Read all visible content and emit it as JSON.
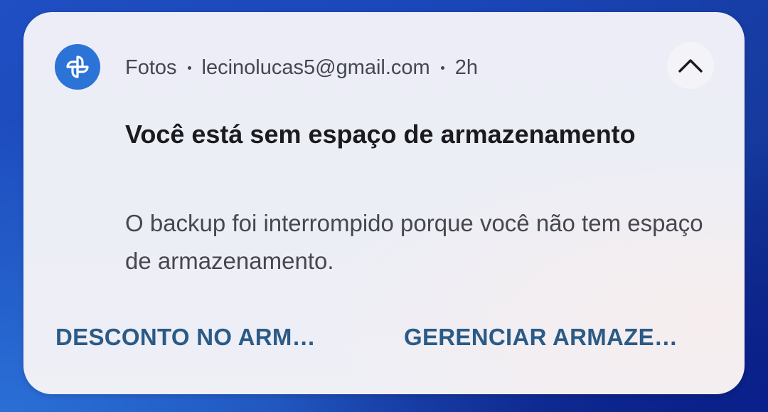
{
  "notification": {
    "app_name": "Fotos",
    "account": "lecinolucas5@gmail.com",
    "time": "2h",
    "app_icon": "google-photos-pinwheel-icon",
    "collapse_icon": "chevron-up-icon",
    "title": "Você está sem espaço de armazenamento",
    "body": "O backup foi interrompido porque você não tem espaço de armazenamento.",
    "actions": [
      {
        "label": "DESCONTO NO ARM…"
      },
      {
        "label": "GERENCIAR ARMAZE…"
      }
    ]
  },
  "colors": {
    "accent": "#2b73d6",
    "action_text": "#2b5a86",
    "card_background": "#ecedf6"
  }
}
